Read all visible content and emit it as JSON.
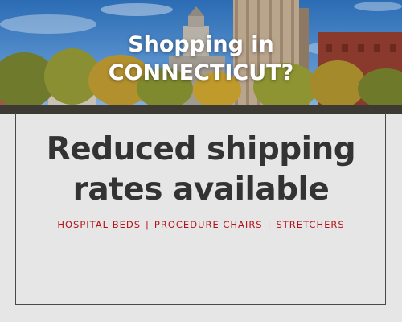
{
  "hero": {
    "headline_line1": "Shopping in",
    "headline_line2": "CONNECTICUT?"
  },
  "main": {
    "headline_line1": "Reduced shipping",
    "headline_line2": "rates available",
    "products": [
      "HOSPITAL BEDS",
      "PROCEDURE CHAIRS",
      "STRETCHERS"
    ],
    "separator": "|"
  },
  "colors": {
    "panel_background": "#e6e6e6",
    "headline_text": "#333333",
    "accent_red": "#b5121b",
    "border": "#4a4a4a",
    "sky": "#2f6fb3"
  }
}
